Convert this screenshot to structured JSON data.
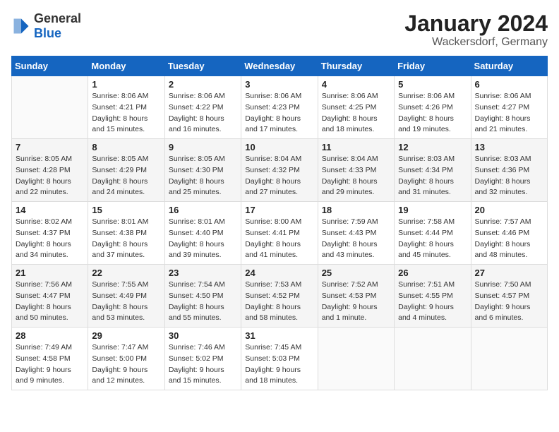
{
  "header": {
    "logo_general": "General",
    "logo_blue": "Blue",
    "title": "January 2024",
    "subtitle": "Wackersdorf, Germany"
  },
  "calendar": {
    "days_of_week": [
      "Sunday",
      "Monday",
      "Tuesday",
      "Wednesday",
      "Thursday",
      "Friday",
      "Saturday"
    ],
    "weeks": [
      [
        {
          "day": "",
          "info": ""
        },
        {
          "day": "1",
          "info": "Sunrise: 8:06 AM\nSunset: 4:21 PM\nDaylight: 8 hours\nand 15 minutes."
        },
        {
          "day": "2",
          "info": "Sunrise: 8:06 AM\nSunset: 4:22 PM\nDaylight: 8 hours\nand 16 minutes."
        },
        {
          "day": "3",
          "info": "Sunrise: 8:06 AM\nSunset: 4:23 PM\nDaylight: 8 hours\nand 17 minutes."
        },
        {
          "day": "4",
          "info": "Sunrise: 8:06 AM\nSunset: 4:25 PM\nDaylight: 8 hours\nand 18 minutes."
        },
        {
          "day": "5",
          "info": "Sunrise: 8:06 AM\nSunset: 4:26 PM\nDaylight: 8 hours\nand 19 minutes."
        },
        {
          "day": "6",
          "info": "Sunrise: 8:06 AM\nSunset: 4:27 PM\nDaylight: 8 hours\nand 21 minutes."
        }
      ],
      [
        {
          "day": "7",
          "info": "Sunrise: 8:05 AM\nSunset: 4:28 PM\nDaylight: 8 hours\nand 22 minutes."
        },
        {
          "day": "8",
          "info": "Sunrise: 8:05 AM\nSunset: 4:29 PM\nDaylight: 8 hours\nand 24 minutes."
        },
        {
          "day": "9",
          "info": "Sunrise: 8:05 AM\nSunset: 4:30 PM\nDaylight: 8 hours\nand 25 minutes."
        },
        {
          "day": "10",
          "info": "Sunrise: 8:04 AM\nSunset: 4:32 PM\nDaylight: 8 hours\nand 27 minutes."
        },
        {
          "day": "11",
          "info": "Sunrise: 8:04 AM\nSunset: 4:33 PM\nDaylight: 8 hours\nand 29 minutes."
        },
        {
          "day": "12",
          "info": "Sunrise: 8:03 AM\nSunset: 4:34 PM\nDaylight: 8 hours\nand 31 minutes."
        },
        {
          "day": "13",
          "info": "Sunrise: 8:03 AM\nSunset: 4:36 PM\nDaylight: 8 hours\nand 32 minutes."
        }
      ],
      [
        {
          "day": "14",
          "info": "Sunrise: 8:02 AM\nSunset: 4:37 PM\nDaylight: 8 hours\nand 34 minutes."
        },
        {
          "day": "15",
          "info": "Sunrise: 8:01 AM\nSunset: 4:38 PM\nDaylight: 8 hours\nand 37 minutes."
        },
        {
          "day": "16",
          "info": "Sunrise: 8:01 AM\nSunset: 4:40 PM\nDaylight: 8 hours\nand 39 minutes."
        },
        {
          "day": "17",
          "info": "Sunrise: 8:00 AM\nSunset: 4:41 PM\nDaylight: 8 hours\nand 41 minutes."
        },
        {
          "day": "18",
          "info": "Sunrise: 7:59 AM\nSunset: 4:43 PM\nDaylight: 8 hours\nand 43 minutes."
        },
        {
          "day": "19",
          "info": "Sunrise: 7:58 AM\nSunset: 4:44 PM\nDaylight: 8 hours\nand 45 minutes."
        },
        {
          "day": "20",
          "info": "Sunrise: 7:57 AM\nSunset: 4:46 PM\nDaylight: 8 hours\nand 48 minutes."
        }
      ],
      [
        {
          "day": "21",
          "info": "Sunrise: 7:56 AM\nSunset: 4:47 PM\nDaylight: 8 hours\nand 50 minutes."
        },
        {
          "day": "22",
          "info": "Sunrise: 7:55 AM\nSunset: 4:49 PM\nDaylight: 8 hours\nand 53 minutes."
        },
        {
          "day": "23",
          "info": "Sunrise: 7:54 AM\nSunset: 4:50 PM\nDaylight: 8 hours\nand 55 minutes."
        },
        {
          "day": "24",
          "info": "Sunrise: 7:53 AM\nSunset: 4:52 PM\nDaylight: 8 hours\nand 58 minutes."
        },
        {
          "day": "25",
          "info": "Sunrise: 7:52 AM\nSunset: 4:53 PM\nDaylight: 9 hours\nand 1 minute."
        },
        {
          "day": "26",
          "info": "Sunrise: 7:51 AM\nSunset: 4:55 PM\nDaylight: 9 hours\nand 4 minutes."
        },
        {
          "day": "27",
          "info": "Sunrise: 7:50 AM\nSunset: 4:57 PM\nDaylight: 9 hours\nand 6 minutes."
        }
      ],
      [
        {
          "day": "28",
          "info": "Sunrise: 7:49 AM\nSunset: 4:58 PM\nDaylight: 9 hours\nand 9 minutes."
        },
        {
          "day": "29",
          "info": "Sunrise: 7:47 AM\nSunset: 5:00 PM\nDaylight: 9 hours\nand 12 minutes."
        },
        {
          "day": "30",
          "info": "Sunrise: 7:46 AM\nSunset: 5:02 PM\nDaylight: 9 hours\nand 15 minutes."
        },
        {
          "day": "31",
          "info": "Sunrise: 7:45 AM\nSunset: 5:03 PM\nDaylight: 9 hours\nand 18 minutes."
        },
        {
          "day": "",
          "info": ""
        },
        {
          "day": "",
          "info": ""
        },
        {
          "day": "",
          "info": ""
        }
      ]
    ]
  }
}
